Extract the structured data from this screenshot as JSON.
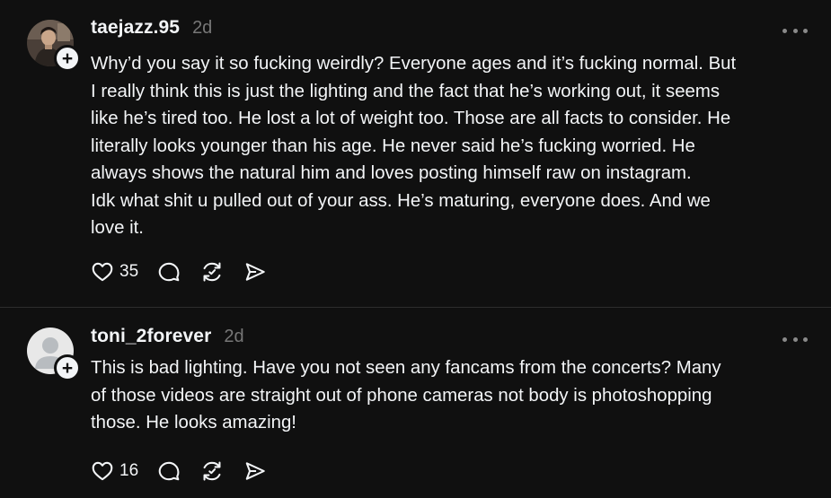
{
  "posts": [
    {
      "username": "taejazz.95",
      "timestamp": "2d",
      "body_lines": [
        "Why’d you say it so fucking weirdly? Everyone ages and it’s fucking normal. But",
        "I really think this is just the lighting and the fact that he’s working out, it seems",
        "like he’s tired too. He lost a lot of weight too. Those are all facts to consider. He",
        "literally looks younger than his age. He never said he’s fucking worried. He",
        "always shows the natural him and loves posting himself raw on instagram.",
        "Idk what shit u pulled out of your ass. He’s maturing, everyone does. And we",
        "love it."
      ],
      "like_count": "35",
      "avatar": "photo-avatar"
    },
    {
      "username": "toni_2forever",
      "timestamp": "2d",
      "body_lines": [
        "This is bad lighting. Have you not seen any fancams from the concerts? Many",
        "of those videos are straight out of phone cameras not body is photoshopping",
        "those. He looks amazing!"
      ],
      "like_count": "16",
      "avatar": "default-avatar"
    }
  ],
  "icons": {
    "like": "heart-icon",
    "reply": "comment-bubble-icon",
    "repost": "repost-icon",
    "share": "send-icon",
    "more": "more-horizontal-icon",
    "follow": "plus-icon"
  },
  "colors": {
    "background": "#101010",
    "text": "#f3f5f7",
    "muted": "#777777",
    "divider": "#2d2d2d"
  }
}
